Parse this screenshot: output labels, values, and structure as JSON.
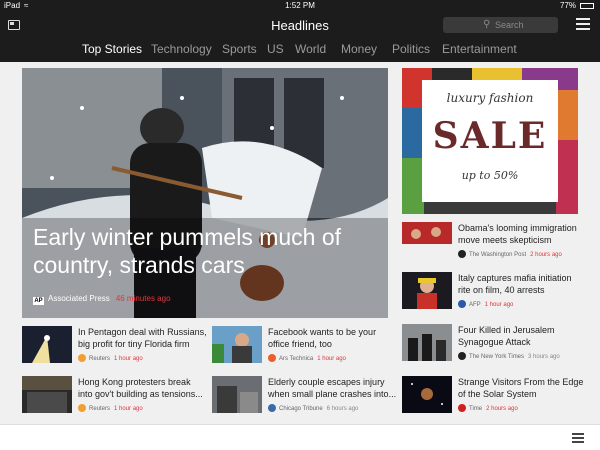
{
  "status": {
    "device": "iPad",
    "time": "1:52 PM",
    "battery": "77%"
  },
  "header": {
    "title": "Headlines",
    "search_placeholder": "Search"
  },
  "tabs": [
    {
      "label": "Top Stories",
      "active": true
    },
    {
      "label": "Technology",
      "active": false
    },
    {
      "label": "Sports",
      "active": false
    },
    {
      "label": "US",
      "active": false
    },
    {
      "label": "World",
      "active": false
    },
    {
      "label": "Money",
      "active": false
    },
    {
      "label": "Politics",
      "active": false
    },
    {
      "label": "Entertainment",
      "active": false
    }
  ],
  "hero": {
    "headline_line1": "Early winter pummels much of",
    "headline_line2": "country, strands cars",
    "source": "Associated Press",
    "source_logo": "AP",
    "time": "46 minutes ago"
  },
  "ad": {
    "line1": "luxury fashion",
    "line2": "SALE",
    "line3": "up to 50%"
  },
  "stories": [
    {
      "line1": "In Pentagon deal with Russians,",
      "line2": "big profit for tiny Florida firm",
      "source": "Reuters",
      "time": "1 hour ago",
      "time_red": true,
      "icon_color": "#f0a030"
    },
    {
      "line1": "Facebook wants to be your",
      "line2": "office friend, too",
      "source": "Ars Technica",
      "time": "1 hour ago",
      "time_red": true,
      "icon_color": "#e8602c"
    },
    {
      "line1": "Hong Kong protesters break",
      "line2": "into gov't building as tensions...",
      "source": "Reuters",
      "time": "1 hour ago",
      "time_red": true,
      "icon_color": "#f0a030"
    },
    {
      "line1": "Elderly couple escapes injury",
      "line2": "when small plane crashes into...",
      "source": "Chicago Tribune",
      "time": "6 hours ago",
      "time_red": false,
      "icon_color": "#3a6aa8"
    },
    {
      "line1": "Obama's looming immigration",
      "line2": "move meets skepticism",
      "source": "The Washington Post",
      "time": "2 hours ago",
      "time_red": true,
      "icon_color": "#222222"
    },
    {
      "line1": "Italy captures mafia initiation",
      "line2": "rite on film, 40 arrests",
      "source": "AFP",
      "time": "1 hour ago",
      "time_red": true,
      "icon_color": "#2a5aa8"
    },
    {
      "line1": "Four Killed in Jerusalem",
      "line2": "Synagogue Attack",
      "source": "The New York Times",
      "time": "3 hours ago",
      "time_red": false,
      "icon_color": "#222222"
    },
    {
      "line1": "Strange Visitors From the Edge",
      "line2": "of the Solar System",
      "source": "Time",
      "time": "2 hours ago",
      "time_red": true,
      "icon_color": "#d02020"
    }
  ]
}
